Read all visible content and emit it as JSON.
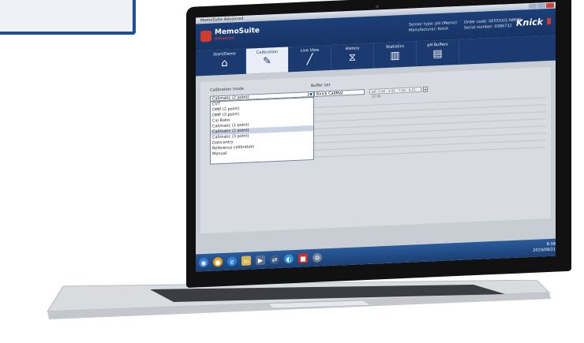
{
  "window": {
    "title": "MemoSuite Advanced"
  },
  "app": {
    "name": "MemoSuite",
    "edition": "Advanced"
  },
  "header": {
    "serial_label": "Sensor type:",
    "serial_value": "pH (Memo)",
    "mfg_label": "Manufacturer:",
    "mfg_value": "Knick",
    "device_label": "Order code:",
    "device_value": "SE555X/1-NMSN",
    "sn_label": "Serial number:",
    "sn_value": "0386732",
    "brand": "Knick"
  },
  "nav": {
    "tabs": [
      {
        "label": "Start/Demo",
        "icon": "home-icon"
      },
      {
        "label": "Calibration",
        "icon": "calibrate-icon",
        "active": true
      },
      {
        "label": "Live View",
        "icon": "pen-icon"
      },
      {
        "label": "History",
        "icon": "chart-icon"
      },
      {
        "label": "Statistics",
        "icon": "statistics-icon"
      },
      {
        "label": "pH Buffers",
        "icon": "document-icon"
      }
    ]
  },
  "calibration": {
    "mode_label": "Calibration mode",
    "buffer_label": "Buffer set",
    "mode_value": "Calimatic (2 point)",
    "buffer_value": "Knick CaliMat",
    "buffer_values": "pH: 2.00 - 4.01 - 7.00 - 9.21 - 12.00",
    "options": [
      "CVT",
      "DMP (2 point)",
      "DMP (3 point)",
      "Cal Ratio",
      "Calimatic (1 point)",
      "Calimatic (2 point)",
      "Calimatic (3 point)",
      "Data entry",
      "Reference calibration",
      "Manual"
    ],
    "selected_index": 5
  },
  "taskbar": {
    "time": "8:38",
    "date": "2019/09/21"
  }
}
